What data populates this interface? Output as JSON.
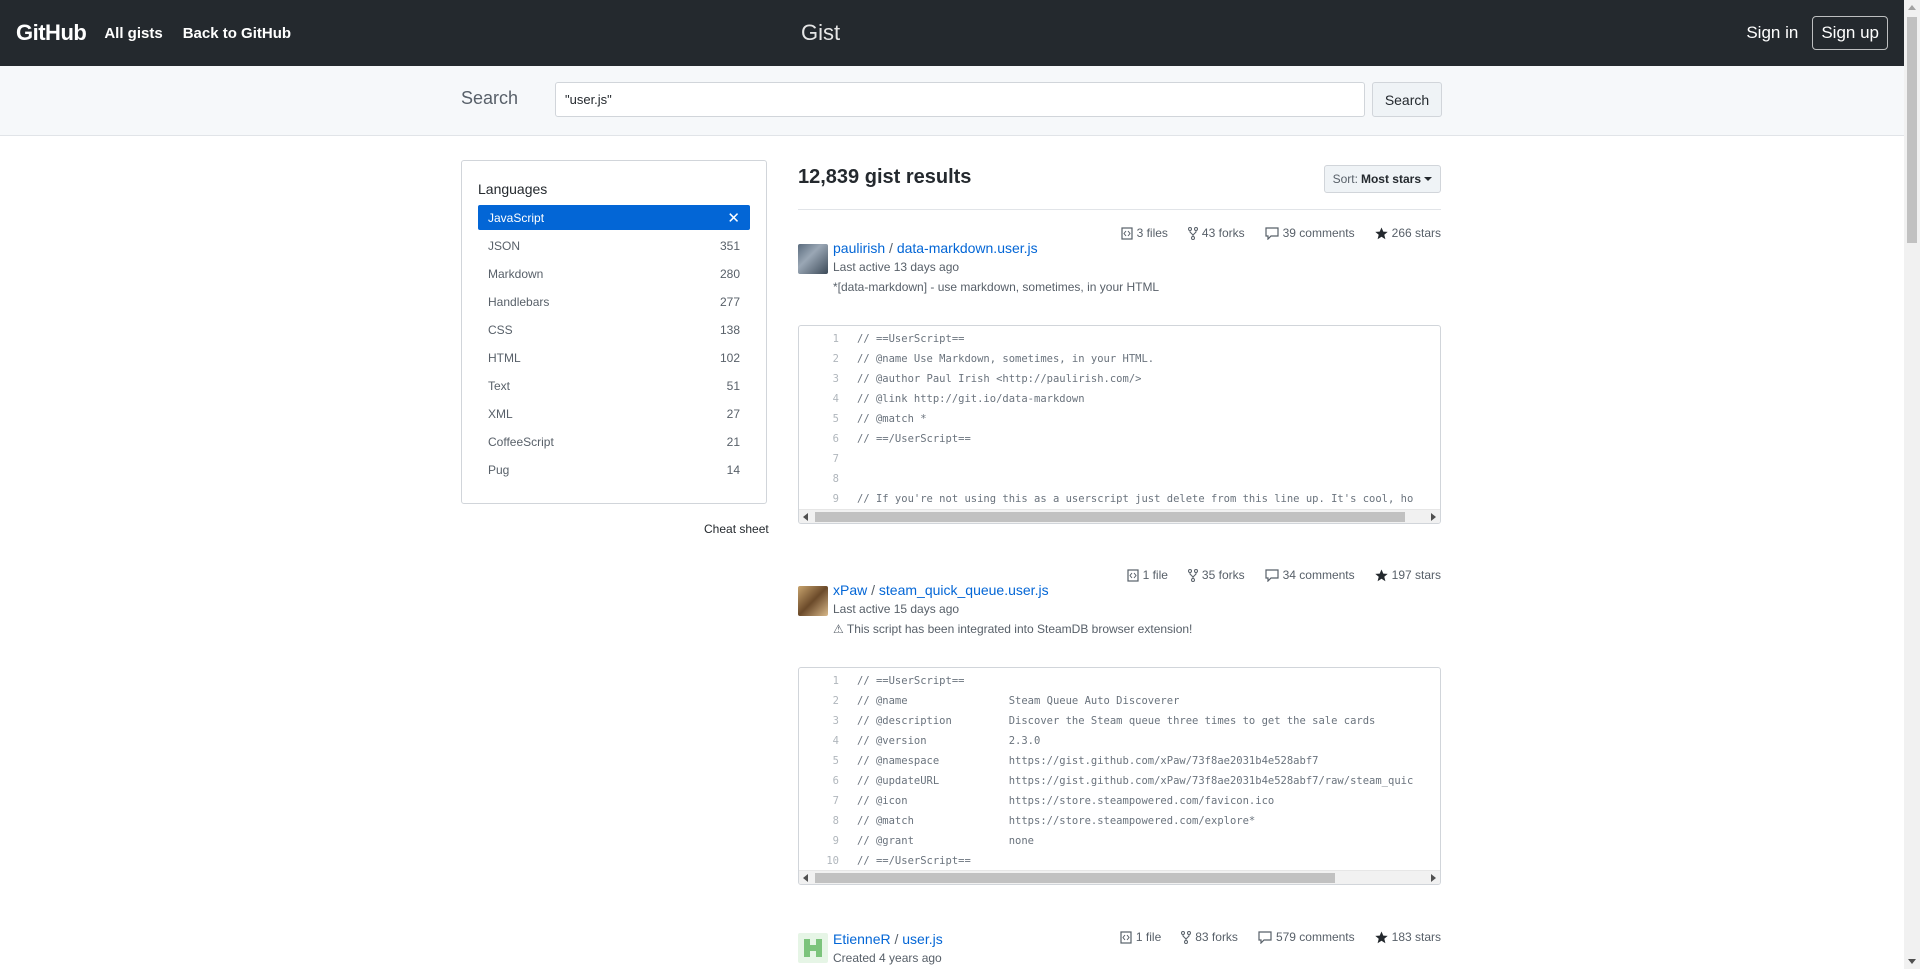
{
  "header": {
    "logo_main": "GitHub",
    "logo_sub": "Gist",
    "nav": [
      "All gists",
      "Back to GitHub"
    ],
    "signin": "Sign in",
    "signup": "Sign up"
  },
  "search": {
    "label": "Search",
    "value": "\"user.js\"",
    "button": "Search"
  },
  "sidebar": {
    "title": "Languages",
    "selected": "JavaScript",
    "selected_close": "✕",
    "items": [
      {
        "name": "JSON",
        "count": "351"
      },
      {
        "name": "Markdown",
        "count": "280"
      },
      {
        "name": "Handlebars",
        "count": "277"
      },
      {
        "name": "CSS",
        "count": "138"
      },
      {
        "name": "HTML",
        "count": "102"
      },
      {
        "name": "Text",
        "count": "51"
      },
      {
        "name": "XML",
        "count": "27"
      },
      {
        "name": "CoffeeScript",
        "count": "21"
      },
      {
        "name": "Pug",
        "count": "14"
      }
    ],
    "cheat_sheet": "Cheat sheet"
  },
  "results": {
    "count": "12,839 gist results",
    "sort_label": "Sort:",
    "sort_value": "Most stars"
  },
  "gists": [
    {
      "files": "3 files",
      "forks": "43 forks",
      "comments": "39 comments",
      "stars": "266 stars",
      "owner": "paulirish",
      "file": "data-markdown.user.js",
      "active": "Last active 13 days ago",
      "description": "*[data-markdown] - use markdown, sometimes, in your HTML",
      "lines": [
        "// ==UserScript==",
        "// @name Use Markdown, sometimes, in your HTML.",
        "// @author Paul Irish <http://paulirish.com/>",
        "// @link http://git.io/data-markdown",
        "// @match *",
        "// ==/UserScript==",
        "",
        "",
        "// If you're not using this as a userscript just delete from this line up. It's cool, ho"
      ]
    },
    {
      "files": "1 file",
      "forks": "35 forks",
      "comments": "34 comments",
      "stars": "197 stars",
      "owner": "xPaw",
      "file": "steam_quick_queue.user.js",
      "active": "Last active 15 days ago",
      "description": "⚠ This script has been integrated into SteamDB browser extension!",
      "lines": [
        "// ==UserScript==",
        "// @name                Steam Queue Auto Discoverer",
        "// @description         Discover the Steam queue three times to get the sale cards",
        "// @version             2.3.0",
        "// @namespace           https://gist.github.com/xPaw/73f8ae2031b4e528abf7",
        "// @updateURL           https://gist.github.com/xPaw/73f8ae2031b4e528abf7/raw/steam_quic",
        "// @icon                https://store.steampowered.com/favicon.ico",
        "// @match               https://store.steampowered.com/explore*",
        "// @grant               none",
        "// ==/UserScript=="
      ]
    },
    {
      "files": "1 file",
      "forks": "83 forks",
      "comments": "579 comments",
      "stars": "183 stars",
      "owner": "EtienneR",
      "file": "user.js",
      "active": "Created 4 years ago"
    }
  ]
}
